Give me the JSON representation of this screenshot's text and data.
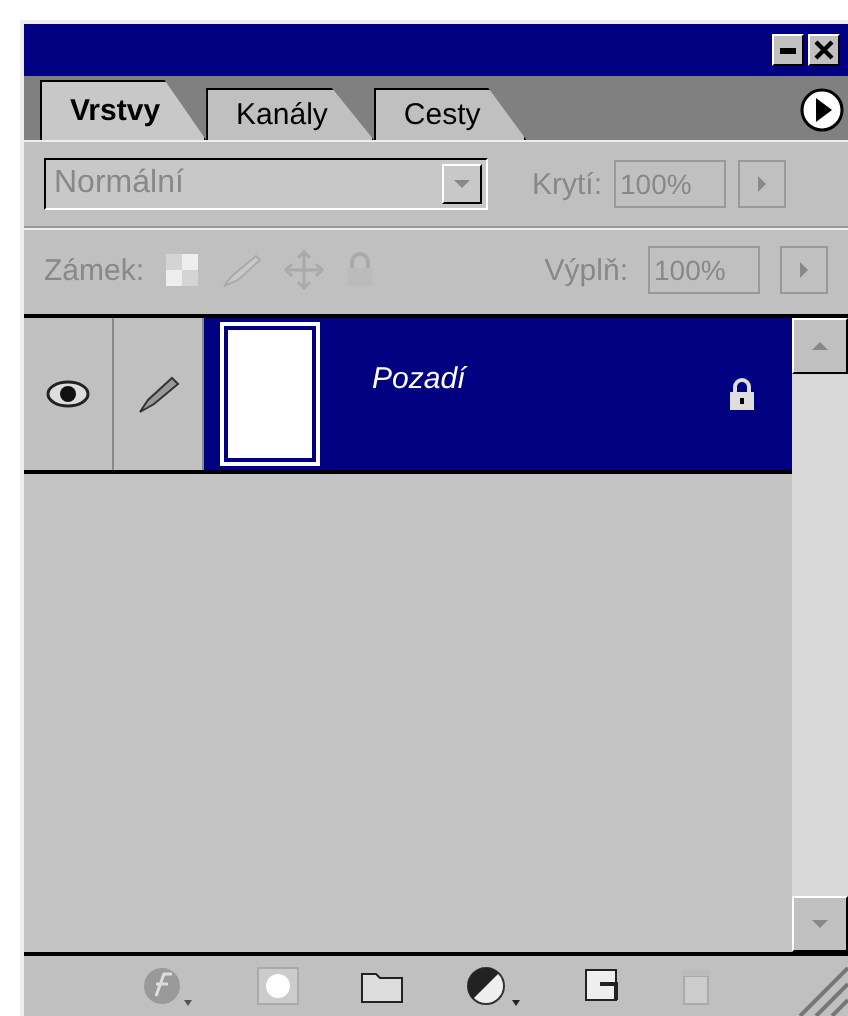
{
  "tabs": [
    {
      "label": "Vrstvy",
      "selected": true
    },
    {
      "label": "Kanály",
      "selected": false
    },
    {
      "label": "Cesty",
      "selected": false
    }
  ],
  "blend_mode": {
    "value": "Normální",
    "disabled": true
  },
  "opacity": {
    "label": "Krytí:",
    "value": "100%",
    "disabled": true
  },
  "lock": {
    "label": "Zámek:",
    "disabled": true
  },
  "fill": {
    "label": "Výplň:",
    "value": "100%",
    "disabled": true
  },
  "layers": [
    {
      "name": "Pozadí",
      "selected": true,
      "visible": true,
      "locked": true
    }
  ]
}
